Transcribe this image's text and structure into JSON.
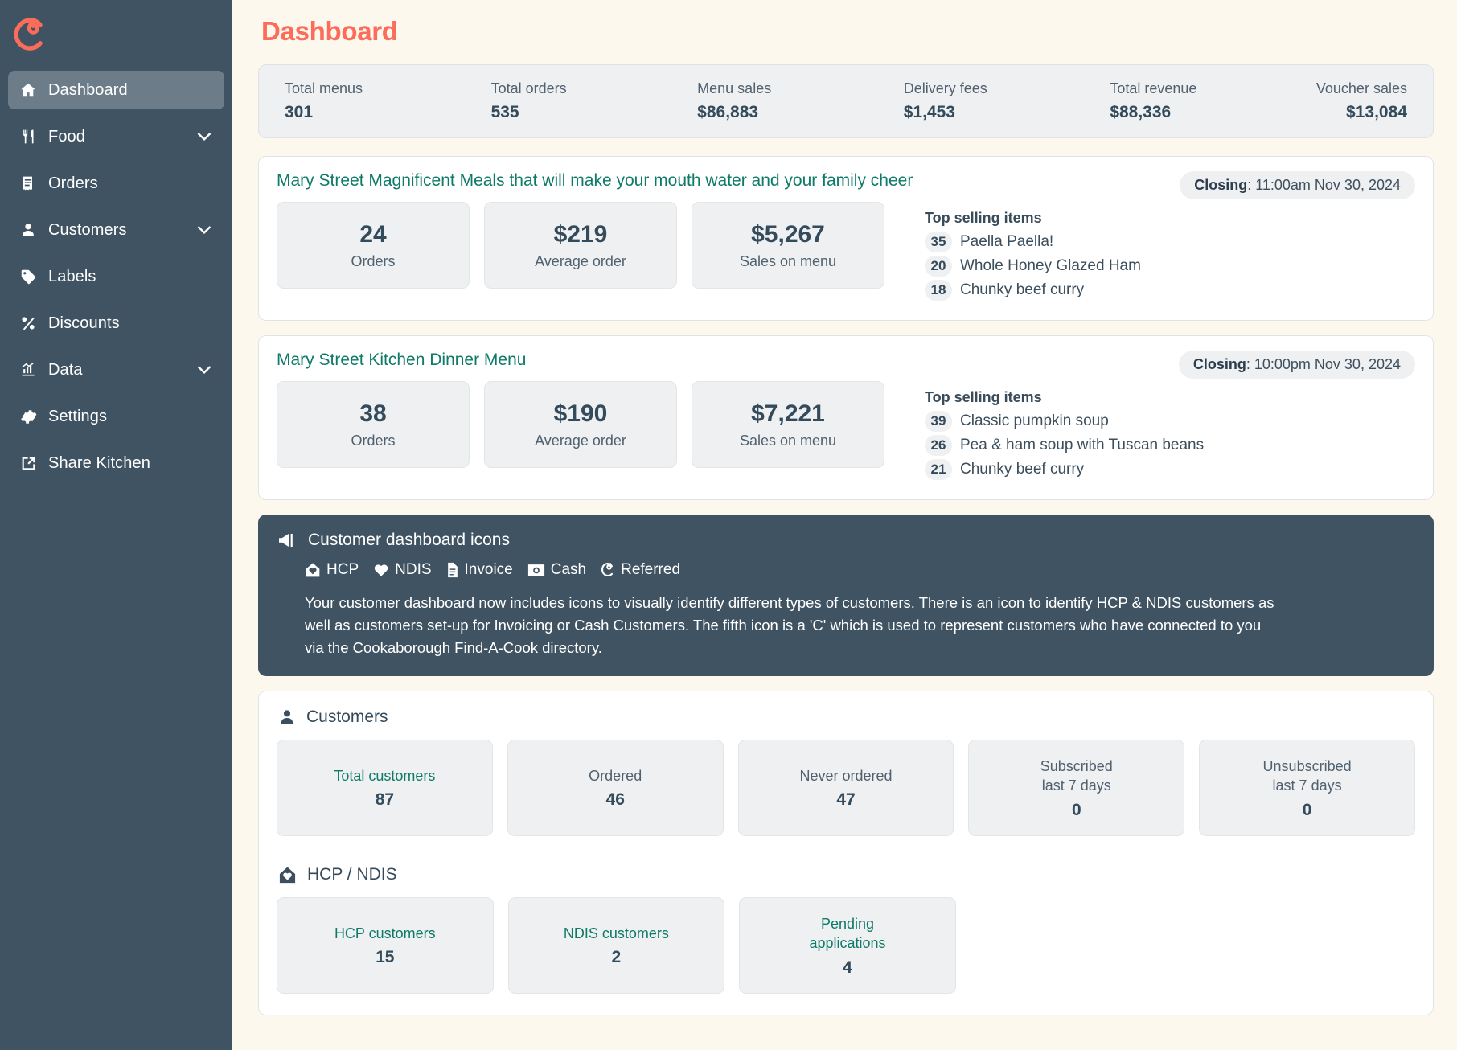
{
  "sidebar": {
    "logo_name": "cookaborough-logo",
    "items": [
      {
        "label": "Dashboard",
        "icon": "home-icon",
        "active": true,
        "expandable": false
      },
      {
        "label": "Food",
        "icon": "cutlery-icon",
        "active": false,
        "expandable": true
      },
      {
        "label": "Orders",
        "icon": "receipt-icon",
        "active": false,
        "expandable": false
      },
      {
        "label": "Customers",
        "icon": "person-icon",
        "active": false,
        "expandable": true
      },
      {
        "label": "Labels",
        "icon": "tag-icon",
        "active": false,
        "expandable": false
      },
      {
        "label": "Discounts",
        "icon": "percent-icon",
        "active": false,
        "expandable": false
      },
      {
        "label": "Data",
        "icon": "bar-chart-icon",
        "active": false,
        "expandable": true
      },
      {
        "label": "Settings",
        "icon": "gear-icon",
        "active": false,
        "expandable": false
      },
      {
        "label": "Share Kitchen",
        "icon": "external-link-icon",
        "active": false,
        "expandable": false
      }
    ]
  },
  "page": {
    "title": "Dashboard",
    "title_color": "#fb6d5a",
    "accent_teal": "#0e7a68",
    "dark_panel": "#3f5362",
    "background": "#fdf8ee"
  },
  "stats": [
    {
      "label": "Total menus",
      "value": "301"
    },
    {
      "label": "Total orders",
      "value": "535"
    },
    {
      "label": "Menu sales",
      "value": "$86,883"
    },
    {
      "label": "Delivery fees",
      "value": "$1,453"
    },
    {
      "label": "Total revenue",
      "value": "$88,336"
    },
    {
      "label": "Voucher sales",
      "value": "$13,084"
    }
  ],
  "menus": [
    {
      "title": "Mary Street Magnificent Meals that will make your mouth water and your family cheer",
      "closing_label": "Closing",
      "closing_value": ": 11:00am Nov 30, 2024",
      "metrics": [
        {
          "value": "24",
          "label": "Orders"
        },
        {
          "value": "$219",
          "label": "Average order"
        },
        {
          "value": "$5,267",
          "label": "Sales on menu"
        }
      ],
      "top_heading": "Top selling items",
      "top_items": [
        {
          "count": "35",
          "name": "Paella Paella!"
        },
        {
          "count": "20",
          "name": "Whole Honey Glazed Ham"
        },
        {
          "count": "18",
          "name": "Chunky beef curry"
        }
      ]
    },
    {
      "title": "Mary Street Kitchen Dinner Menu",
      "closing_label": "Closing",
      "closing_value": ": 10:00pm Nov 30, 2024",
      "metrics": [
        {
          "value": "38",
          "label": "Orders"
        },
        {
          "value": "$190",
          "label": "Average order"
        },
        {
          "value": "$7,221",
          "label": "Sales on menu"
        }
      ],
      "top_heading": "Top selling items",
      "top_items": [
        {
          "count": "39",
          "name": "Classic pumpkin soup"
        },
        {
          "count": "26",
          "name": "Pea & ham soup with Tuscan beans"
        },
        {
          "count": "21",
          "name": "Chunky beef curry"
        }
      ]
    }
  ],
  "notice": {
    "icon": "megaphone-icon",
    "heading": "Customer dashboard icons",
    "legend": [
      {
        "icon": "house-heart-icon",
        "label": "HCP"
      },
      {
        "icon": "heart-icon",
        "label": "NDIS"
      },
      {
        "icon": "invoice-icon",
        "label": "Invoice"
      },
      {
        "icon": "cash-icon",
        "label": "Cash"
      },
      {
        "icon": "c-swirl-icon",
        "label": "Referred"
      }
    ],
    "body": "Your customer dashboard now includes icons to visually identify different types of customers. There is an icon to identify HCP & NDIS customers as well as customers set-up for Invoicing or Cash Customers. The fifth icon is a 'C' which is used to represent customers who have connected to you via the Cookaborough Find-A-Cook directory."
  },
  "customers_section": {
    "icon": "person-icon",
    "heading": "Customers",
    "tiles": [
      {
        "label": "Total customers",
        "value": "87",
        "link": true
      },
      {
        "label": "Ordered",
        "value": "46",
        "link": false
      },
      {
        "label": "Never ordered",
        "value": "47",
        "link": false
      },
      {
        "label": "Subscribed\nlast 7 days",
        "value": "0",
        "link": false
      },
      {
        "label": "Unsubscribed\nlast 7 days",
        "value": "0",
        "link": false
      }
    ]
  },
  "hcp_section": {
    "icon": "house-heart-icon",
    "heading": "HCP / NDIS",
    "tiles": [
      {
        "label": "HCP customers",
        "value": "15",
        "link": true
      },
      {
        "label": "NDIS customers",
        "value": "2",
        "link": true
      },
      {
        "label": "Pending\napplications",
        "value": "4",
        "link": true
      }
    ]
  }
}
